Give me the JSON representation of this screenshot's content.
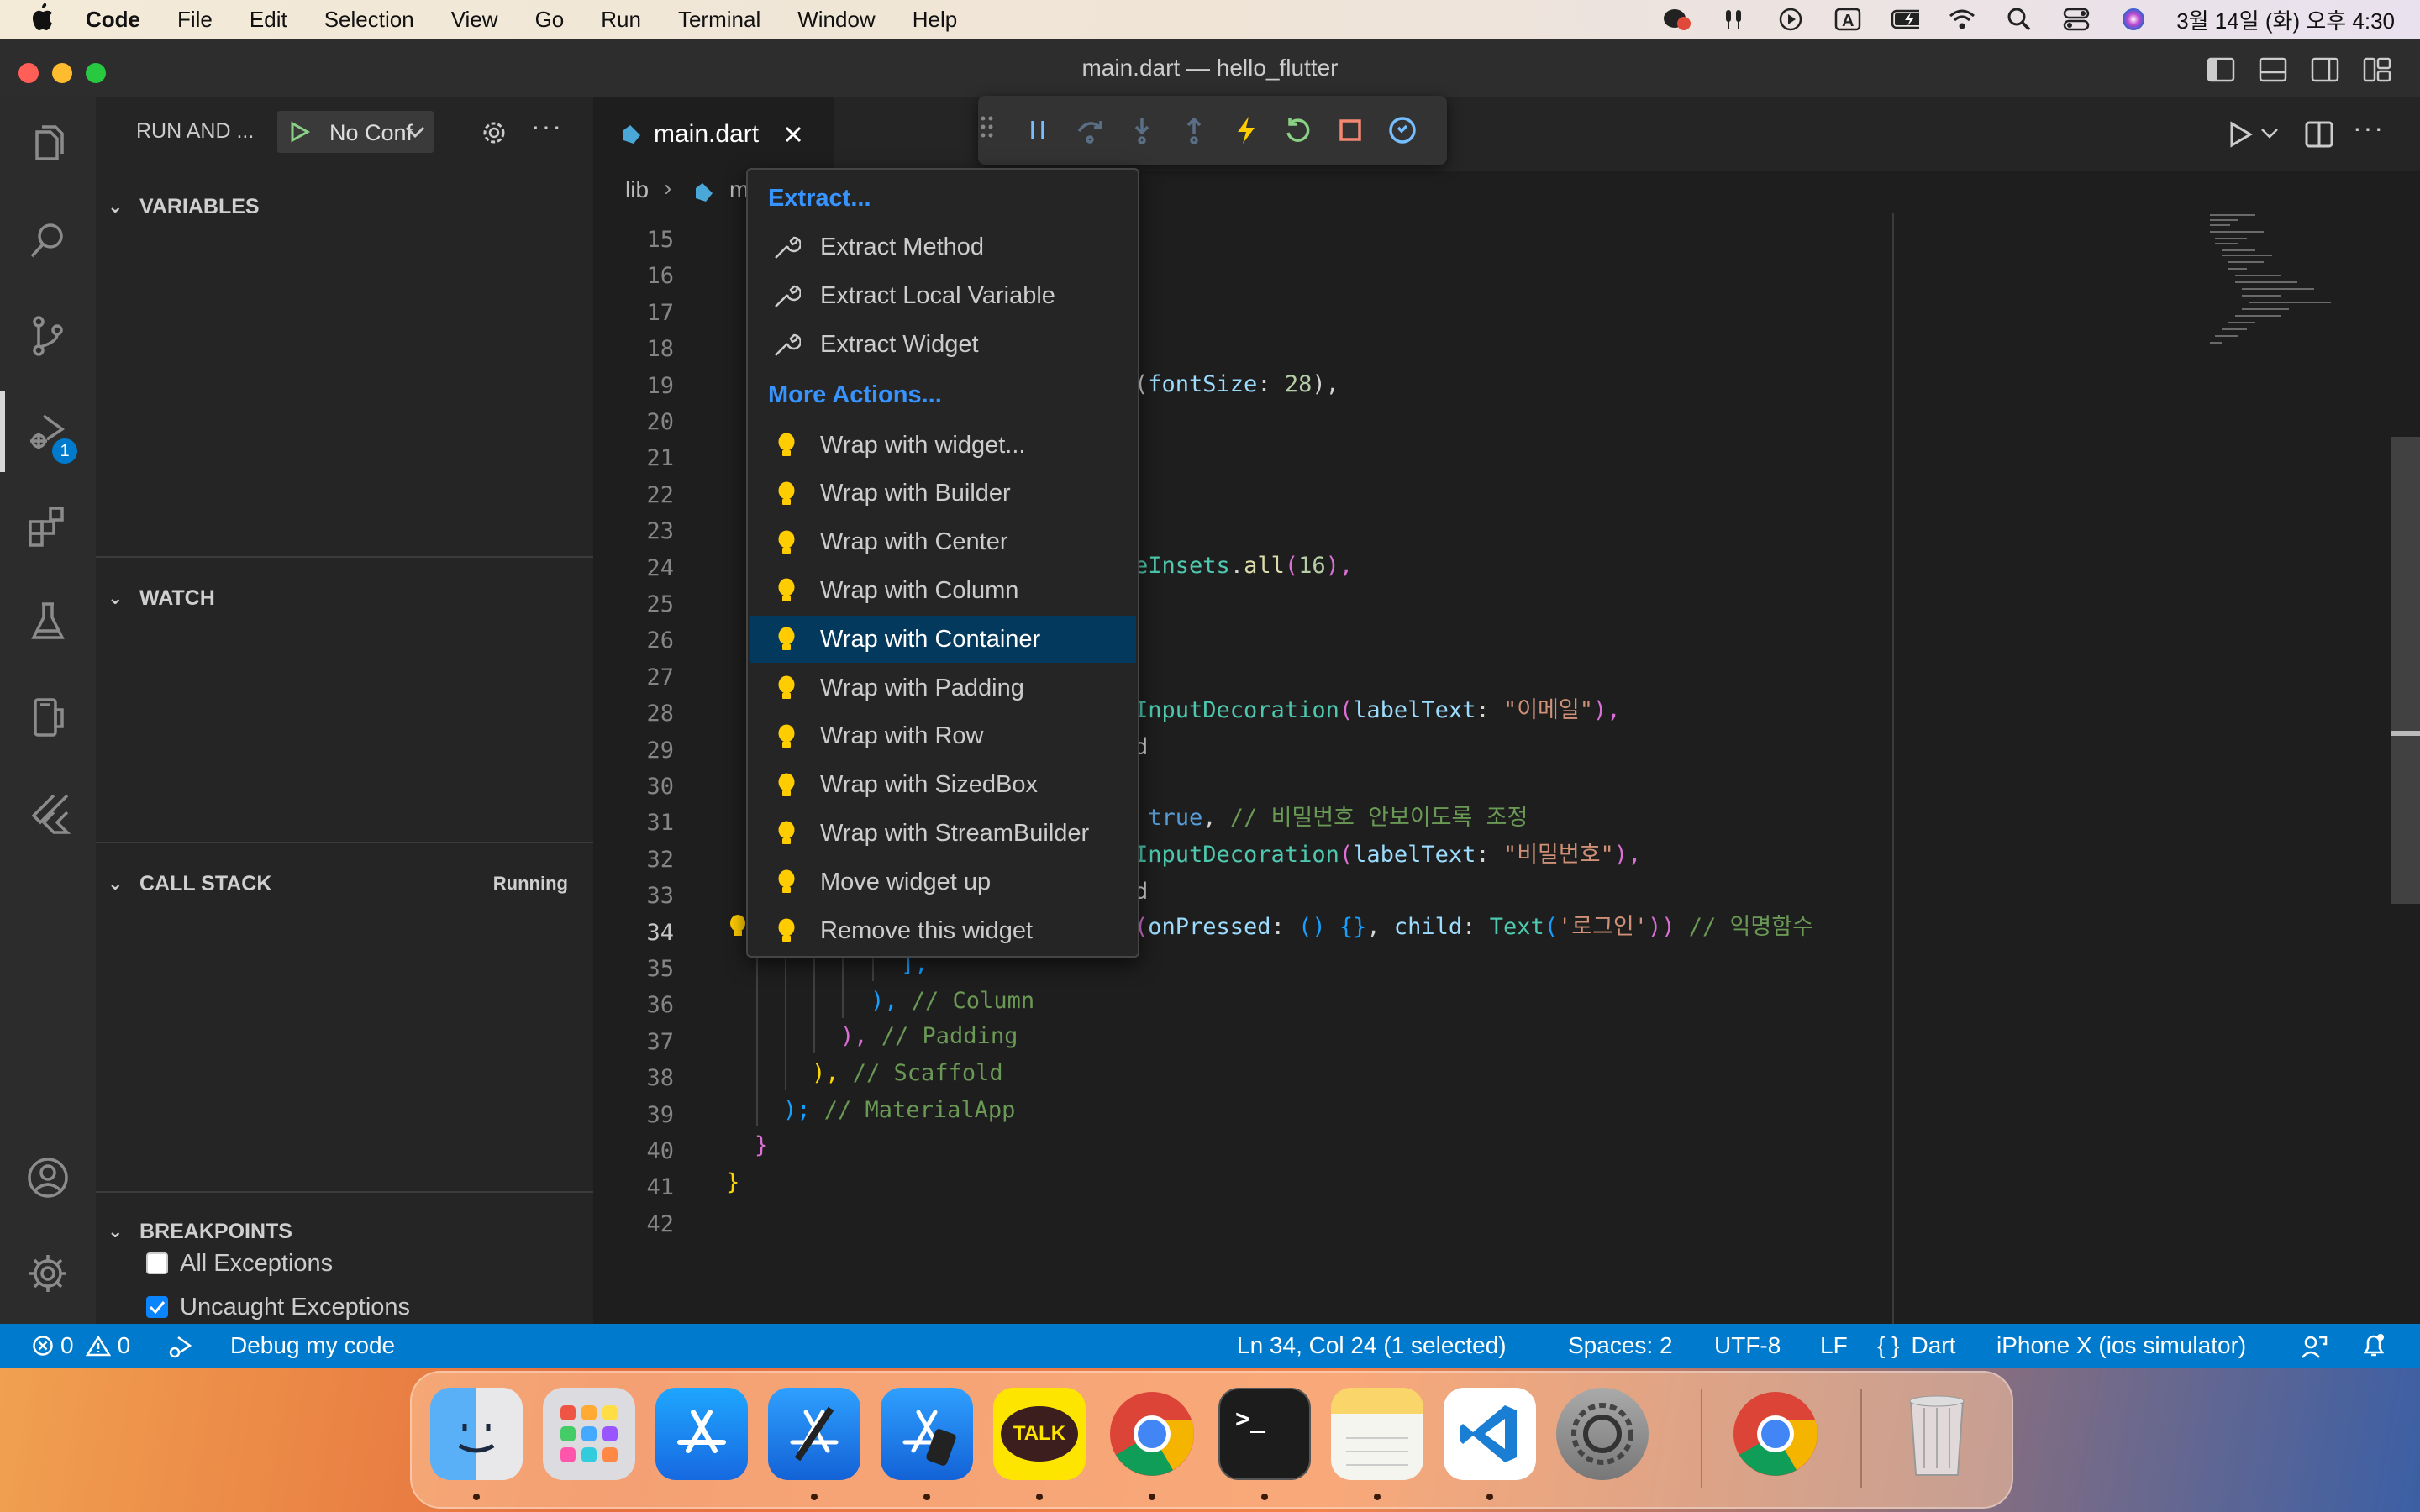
{
  "menubar": {
    "app": "Code",
    "items": [
      "File",
      "Edit",
      "Selection",
      "View",
      "Go",
      "Run",
      "Terminal",
      "Window",
      "Help"
    ],
    "clock": "3월 14일 (화) 오후 4:30"
  },
  "window": {
    "title": "main.dart — hello_flutter"
  },
  "sidebar": {
    "run_title": "RUN AND ...",
    "config": "No Conf",
    "sections": {
      "variables": "VARIABLES",
      "watch": "WATCH",
      "call_stack": "CALL STACK",
      "call_stack_status": "Running",
      "breakpoints": "BREAKPOINTS"
    },
    "breakpoints": [
      {
        "label": "All Exceptions",
        "checked": false
      },
      {
        "label": "Uncaught Exceptions",
        "checked": true
      }
    ]
  },
  "activity": {
    "debug_badge": "1"
  },
  "tab": {
    "label": "main.dart"
  },
  "breadcrumb": {
    "root": "lib",
    "file": "m"
  },
  "editor": {
    "line_numbers": [
      "15",
      "16",
      "17",
      "18",
      "19",
      "20",
      "21",
      "22",
      "23",
      "24",
      "25",
      "26",
      "27",
      "28",
      "29",
      "30",
      "31",
      "32",
      "33",
      "34",
      "35",
      "36",
      "37",
      "38",
      "39",
      "40",
      "41",
      "42"
    ],
    "current_line": "34",
    "code": {
      "l19": [
        "(",
        "fontSize",
        ": ",
        "28",
        "),"
      ],
      "l24": [
        "eInsets",
        ".",
        "all",
        "(",
        "16",
        "),"
      ],
      "l28": [
        "InputDecoration",
        "(",
        "labelText",
        ": ",
        "\"이메일\"",
        "),"
      ],
      "l29": "d",
      "l31": [
        " true",
        ", ",
        "// 비밀번호 안보이도록 조정"
      ],
      "l32": [
        "InputDecoration",
        "(",
        "labelText",
        ": ",
        "\"비밀번호\"",
        "),"
      ],
      "l33": "d",
      "l34": [
        "(",
        "onPressed",
        ": ",
        "() {}",
        ", ",
        "child",
        ": ",
        "Text",
        "(",
        "'로그인'",
        "))",
        " // 익명함수"
      ],
      "l35": "],",
      "l36": [
        "), ",
        "// Column"
      ],
      "l37": [
        "), ",
        "// Padding"
      ],
      "l38": [
        "), ",
        "// Scaffold"
      ],
      "l39": [
        "); ",
        "// MaterialApp"
      ],
      "l40": "}",
      "l41": "}"
    }
  },
  "context_menu": {
    "header_extract": "Extract...",
    "extract_items": [
      "Extract Method",
      "Extract Local Variable",
      "Extract Widget"
    ],
    "header_more": "More Actions...",
    "action_items": [
      "Wrap with widget...",
      "Wrap with Builder",
      "Wrap with Center",
      "Wrap with Column",
      "Wrap with Container",
      "Wrap with Padding",
      "Wrap with Row",
      "Wrap with SizedBox",
      "Wrap with StreamBuilder",
      "Move widget up",
      "Remove this widget"
    ],
    "selected": "Wrap with Container"
  },
  "statusbar": {
    "errors": "0",
    "warnings": "0",
    "debug": "Debug my code",
    "position": "Ln 34, Col 24 (1 selected)",
    "spaces": "Spaces: 2",
    "encoding": "UTF-8",
    "eol": "LF",
    "language": "Dart",
    "device": "iPhone X (ios simulator)"
  },
  "dock": {
    "kakao": "TALK",
    "terminal": ">_"
  },
  "colors": {
    "accent": "#007acc",
    "selection": "#04395e",
    "link": "#3794ff"
  }
}
